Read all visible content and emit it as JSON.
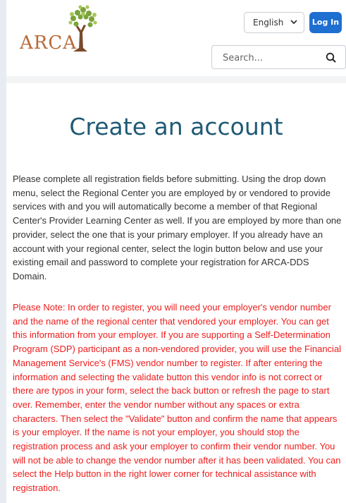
{
  "header": {
    "logo_text": "ARCA",
    "language": {
      "selected": "English"
    },
    "login_label": "Log In",
    "search": {
      "placeholder": "Search...",
      "icon": "search-icon"
    }
  },
  "main": {
    "title": "Create an account",
    "intro": "Please complete all registration fields before submitting. Using the drop down menu, select the Regional Center you are employed by or vendored to provide services with and you will automatically become a member of that Regional Center's Provider Learning Center as well. If you are employed by more than one provider, select the one that is your primary employer. If you already have an account with your regional center, select the login button below and use your existing email and password to complete your registration for ARCA-DDS Domain.",
    "note": "Please Note: In order to register, you will need your employer's vendor number and the name of the regional center that vendored your employer. You can get this information from your employer. If you are supporting a Self-Determination Program (SDP) participant as a non-vendored provider, you will use the Financial Management Service's (FMS) vendor number to register. If after entering the information and selecting the validate button this vendor info is not correct or there are typos in your form, select the back button or refresh the page to start over. Remember, enter the vendor number without any spaces or extra characters. Then select the \"Validate\" button and confirm the name that appears is your employer. If the name is not your employer, you should stop the registration process and ask your employer to confirm their vendor number. You will not be able to change the vendor number after it has been validated. You can select the Help button in the right lower corner for technical assistance with registration."
  },
  "colors": {
    "title": "#1f5a75",
    "note_text": "#ee1c1c",
    "login_button": "#1e6fd0",
    "logo_text": "#b86a37"
  }
}
